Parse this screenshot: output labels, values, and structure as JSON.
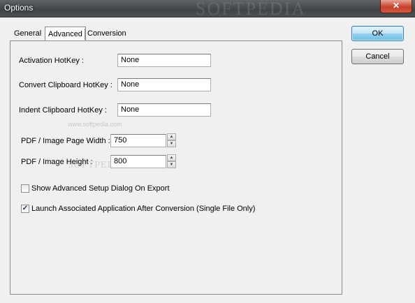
{
  "window": {
    "title": "Options",
    "close_glyph": "✕",
    "title_watermark": "SOFTPEDIA"
  },
  "tabs": [
    {
      "label": "General",
      "active": false
    },
    {
      "label": "Advanced",
      "active": true
    },
    {
      "label": "Conversion",
      "active": false
    }
  ],
  "hotkeys": {
    "activation": {
      "label": "Activation HotKey :",
      "value": "None"
    },
    "convert_clipboard": {
      "label": "Convert Clipboard HotKey :",
      "value": "None"
    },
    "indent_clipboard": {
      "label": "Indent Clipboard HotKey :",
      "value": "None"
    }
  },
  "page_size": {
    "width": {
      "label": "PDF / Image Page Width :",
      "value": "750"
    },
    "height": {
      "label": "PDF / Image Height :",
      "value": "800"
    }
  },
  "spinner": {
    "up_glyph": "▲",
    "down_glyph": "▼"
  },
  "options": {
    "show_advanced_setup": {
      "label": "Show Advanced Setup Dialog On Export",
      "checked": false
    },
    "launch_associated_app": {
      "label": "Launch Associated Application After Conversion (Single File Only)",
      "checked": true,
      "check_glyph": "✓"
    }
  },
  "buttons": {
    "ok": "OK",
    "cancel": "Cancel"
  },
  "watermark": {
    "text": "SOFTPEDIA",
    "subtext": "www.softpedia.com"
  },
  "icons": {
    "close": "close-icon",
    "spin_up": "arrow-up-icon",
    "spin_down": "arrow-down-icon",
    "check": "check-icon"
  }
}
